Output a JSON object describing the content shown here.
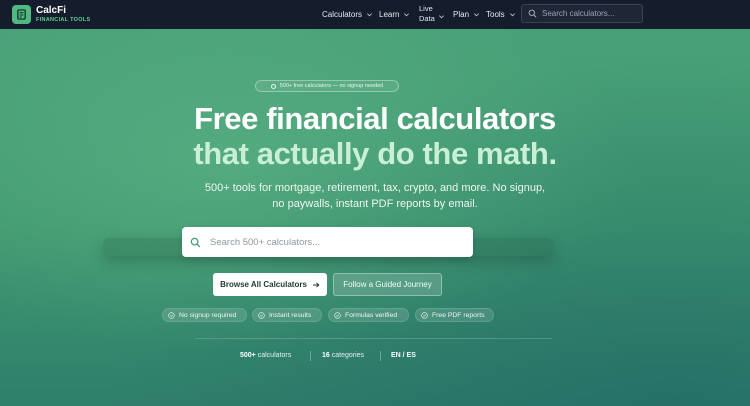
{
  "brand": {
    "name": "CalcFi",
    "tagline": "FINANCIAL TOOLS"
  },
  "nav": {
    "items": [
      "Calculators",
      "Learn",
      "Plan",
      "Tools"
    ],
    "live_data_line1": "Live",
    "live_data_line2": "Data",
    "search_placeholder": "Search calculators..."
  },
  "hero": {
    "pill": "500+ free calculators — no signup needed",
    "title_line1": "Free financial calculators",
    "title_line2": "that actually do the math.",
    "subtitle_line1": "500+ tools for mortgage, retirement, tax, crypto, and more. No signup,",
    "subtitle_line2": "no paywalls, instant PDF reports by email.",
    "search_placeholder": "Search 500+ calculators...",
    "primary_button": "Browse All Calculators",
    "secondary_button": "Follow a Guided Journey",
    "features": [
      "No signup required",
      "Instant results",
      "Formulas verified",
      "Free PDF reports"
    ]
  },
  "stats": {
    "calculators_value": "500+",
    "calculators_label": "calculators",
    "categories_value": "16",
    "categories_label": "categories",
    "languages": "EN / ES"
  },
  "colors": {
    "nav_bg": "#151c2c",
    "accent": "#4fb883",
    "hero_green": "#3f9870"
  }
}
